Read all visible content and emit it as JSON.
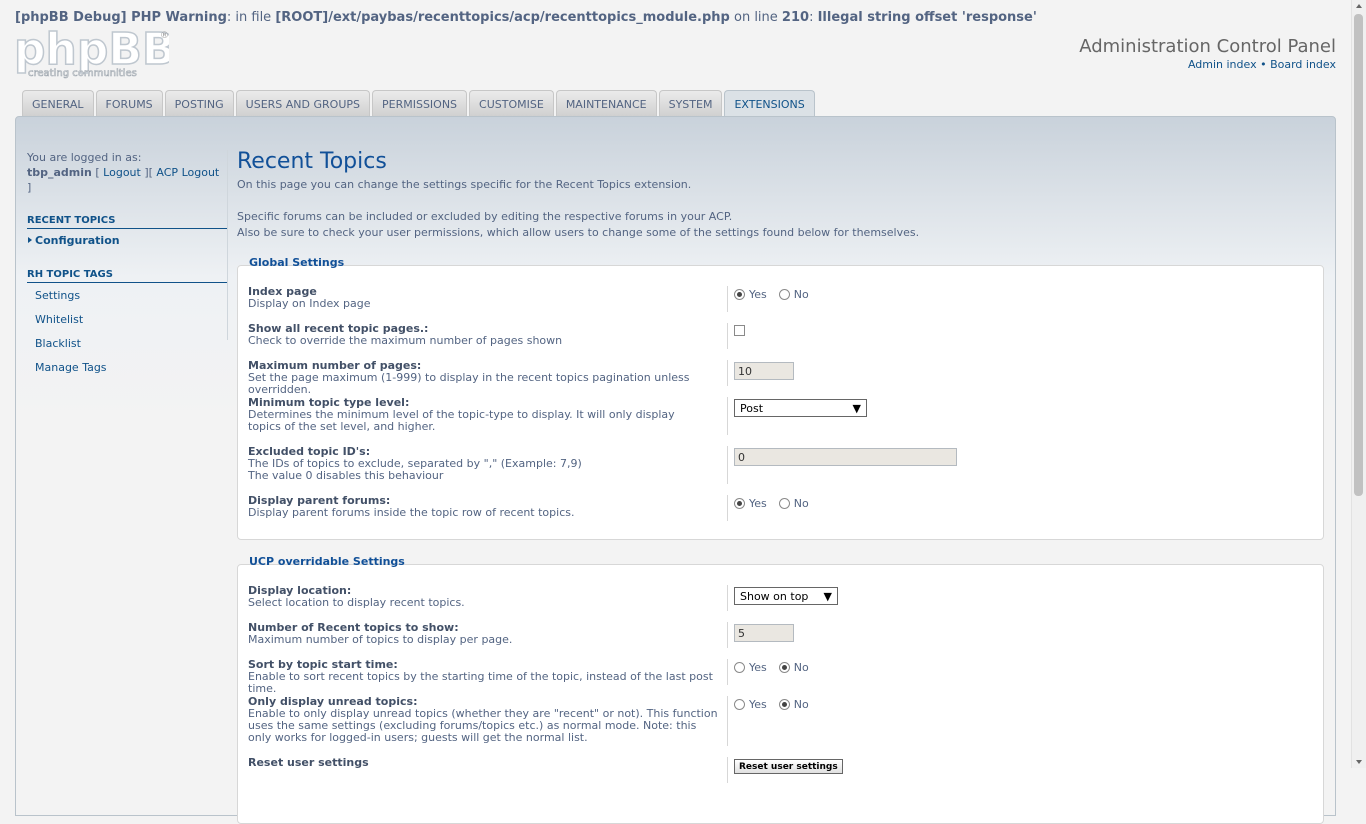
{
  "debug": {
    "prefix": "[phpBB Debug] PHP Warning",
    "text1": ": in file ",
    "file": "[ROOT]/ext/paybas/recenttopics/acp/recenttopics_module.php",
    "text2": " on line ",
    "line": "210",
    "text3": ": ",
    "message": "Illegal string offset 'response'"
  },
  "logo": {
    "main": "phpBB",
    "tagline": "creating communities"
  },
  "header": {
    "title": "Administration Control Panel",
    "admin_index": "Admin index",
    "sep": " • ",
    "board_index": "Board index"
  },
  "tabs": [
    "General",
    "Forums",
    "Posting",
    "Users and Groups",
    "Permissions",
    "Customise",
    "Maintenance",
    "System",
    "Extensions"
  ],
  "sidebar": {
    "logged_in_as": "You are logged in as:",
    "username": "tbp_admin",
    "logout": "Logout",
    "acp_logout": "ACP Logout",
    "bracket_open": " [ ",
    "bracket_mid": " ][ ",
    "bracket_close": " ]",
    "section1": "Recent Topics",
    "section1_items": [
      "Configuration"
    ],
    "section2": "RH Topic Tags",
    "section2_items": [
      "Settings",
      "Whitelist",
      "Blacklist",
      "Manage Tags"
    ]
  },
  "main": {
    "title": "Recent Topics",
    "intro1": "On this page you can change the settings specific for the Recent Topics extension.",
    "intro2": "Specific forums can be included or excluded by editing the respective forums in your ACP.",
    "intro3": "Also be sure to check your user permissions, which allow users to change some of the settings found below for themselves."
  },
  "global": {
    "legend": "Global Settings",
    "yes": "Yes",
    "no": "No",
    "index_label": "Index page",
    "index_expl": "Display on Index page",
    "showall_label": "Show all recent topic pages.:",
    "showall_expl": "Check to override the maximum number of pages shown",
    "maxpages_label": "Maximum number of pages:",
    "maxpages_expl": "Set the page maximum (1-999) to display in the recent topics pagination unless overridden.",
    "maxpages_value": "10",
    "mintype_label": "Minimum topic type level:",
    "mintype_expl": "Determines the minimum level of the topic-type to display. It will only display topics of the set level, and higher.",
    "mintype_value": "Post",
    "excluded_label": "Excluded topic ID's:",
    "excluded_expl1": "The IDs of topics to exclude, separated by \",\" (Example: 7,9)",
    "excluded_expl2": "The value 0 disables this behaviour",
    "excluded_value": "0",
    "parent_label": "Display parent forums:",
    "parent_expl": "Display parent forums inside the topic row of recent topics."
  },
  "ucp": {
    "legend": "UCP overridable Settings",
    "location_label": "Display location:",
    "location_expl": "Select location to display recent topics.",
    "location_value": "Show on top",
    "number_label": "Number of Recent topics to show:",
    "number_expl": "Maximum number of topics to display per page.",
    "number_value": "5",
    "sort_label": "Sort by topic start time:",
    "sort_expl": "Enable to sort recent topics by the starting time of the topic, instead of the last post time.",
    "unread_label": "Only display unread topics:",
    "unread_expl": "Enable to only display unread topics (whether they are \"recent\" or not). This function uses the same settings (excluding forums/topics etc.) as normal mode. Note: this only works for logged-in users; guests will get the normal list.",
    "reset_label": "Reset user settings",
    "reset_button": "Reset user settings"
  }
}
